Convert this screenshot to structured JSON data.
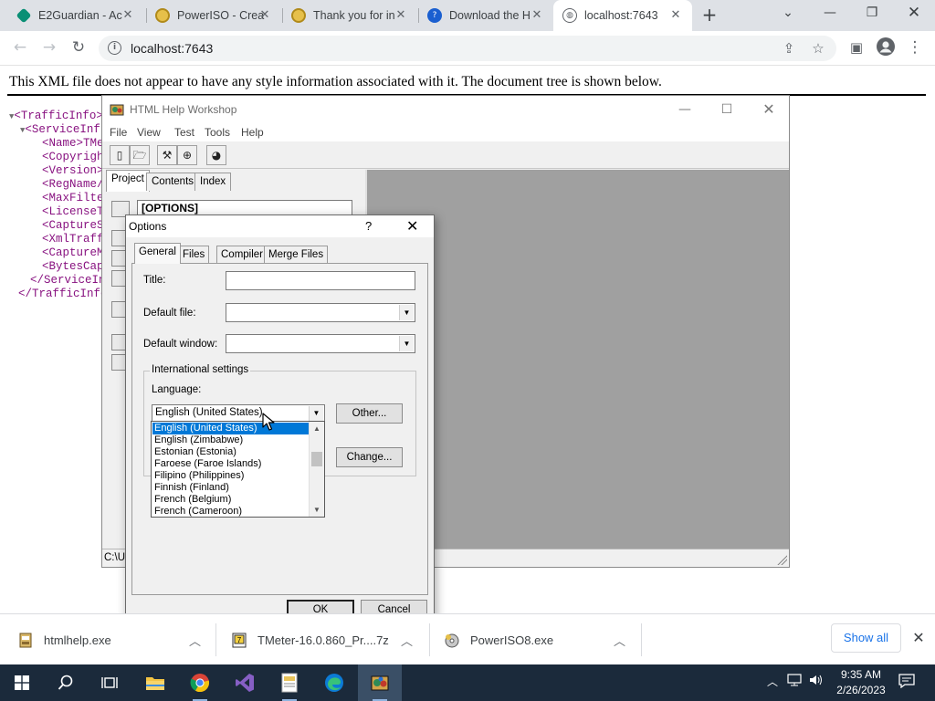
{
  "browser": {
    "tabs": [
      {
        "title": "E2Guardian - Ac",
        "icon": "e2guardian-icon",
        "color": "#0a8f75"
      },
      {
        "title": "PowerISO - Crea",
        "icon": "poweriso-icon",
        "color": "#c9a227"
      },
      {
        "title": "Thank you for in",
        "icon": "poweriso-icon",
        "color": "#c9a227"
      },
      {
        "title": "Download the H",
        "icon": "download-site-icon",
        "color": "#1a5fd0"
      },
      {
        "title": "localhost:7643",
        "icon": "globe-icon",
        "color": "#5f6368",
        "active": true
      }
    ],
    "address": "localhost:7643"
  },
  "page": {
    "xml_notice": "This XML file does not appear to have any style information associated with it. The document tree is shown below.",
    "tree_lines": [
      "<TrafficInfo>",
      "<ServiceInf",
      "<Name>TMe",
      "<Copyrigh",
      "<Version>",
      "<RegName/",
      "<MaxFilte",
      "<LicenseT",
      "<CaptureS",
      "<XmlTraff",
      "<CaptureM",
      "<BytesCap",
      "</ServiceIn",
      "</TrafficInfo"
    ]
  },
  "hhw": {
    "title": "HTML Help Workshop",
    "menu": [
      "File",
      "View",
      "Test",
      "Tools",
      "Help"
    ],
    "tabs": [
      "Project",
      "Contents",
      "Index"
    ],
    "options_header": "[OPTIONS]",
    "status": "C:\\U"
  },
  "dialog": {
    "title": "Options",
    "help_glyph": "?",
    "tabs": [
      "General",
      "Files",
      "Compiler",
      "Merge Files"
    ],
    "title_label": "Title:",
    "title_value": "",
    "default_file_label": "Default file:",
    "default_file_value": "",
    "default_window_label": "Default window:",
    "default_window_value": "",
    "intl_group": "International settings",
    "language_label": "Language:",
    "language_value": "English (United States)",
    "other_button": "Other...",
    "change_button": "Change...",
    "ok_button": "OK",
    "cancel_button": "Cancel",
    "language_options": [
      "English (United States)",
      "English (Zimbabwe)",
      "Estonian (Estonia)",
      "Faroese (Faroe Islands)",
      "Filipino (Philippines)",
      "Finnish (Finland)",
      "French (Belgium)",
      "French (Cameroon)"
    ]
  },
  "downloads": [
    {
      "name": "htmlhelp.exe",
      "icon": "installer-icon"
    },
    {
      "name": "TMeter-16.0.860_Pr....7z",
      "icon": "archive-icon"
    },
    {
      "name": "PowerISO8.exe",
      "icon": "poweriso-icon"
    }
  ],
  "shelf": {
    "show_all": "Show all"
  },
  "taskbar": {
    "time": "9:35 AM",
    "date": "2/26/2023"
  },
  "colors": {
    "selection": "#0078d7",
    "taskbar": "#1b2a3b",
    "link_blue": "#1a73e8"
  }
}
